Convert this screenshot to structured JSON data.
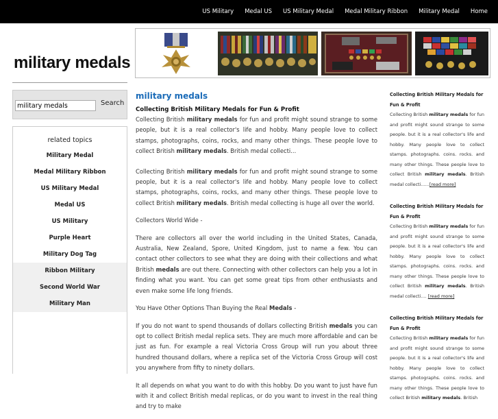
{
  "topnav": [
    "US Military",
    "Medal US",
    "US Military Medal",
    "Medal Military Ribbon",
    "Military Medal",
    "Home"
  ],
  "site_title": "military medals",
  "search": {
    "value": "military medals",
    "button": "Search"
  },
  "topics": {
    "heading": "related topics",
    "items": [
      "Military Medal",
      "Medal Military Ribbon",
      "US Military Medal",
      "Medal US",
      "US Military",
      "Purple Heart",
      "Military Dog Tag",
      "Ribbon Military",
      "Second World War",
      "Military Man"
    ]
  },
  "main": {
    "title": "military medals",
    "article_title": "Collecting British Military Medals for Fun & Profit",
    "p1_a": "Collecting British ",
    "p1_b": "military medals",
    "p1_c": " for fun and profit might sound strange to some people, but it is a real collector's life and hobby. Many people love to collect stamps, photographs, coins, rocks, and many other things. These people love to collect British ",
    "p1_d": "military medals",
    "p1_e": ". British medal collecti...",
    "p2_a": "Collecting British ",
    "p2_b": "military medals",
    "p2_c": " for fun and profit might sound strange to some people, but it is a real collector's life and hobby. Many people love to collect stamps, photographs, coins, rocks, and many other things. These people love to collect British ",
    "p2_d": "military medals",
    "p2_e": ". British medal collecting is huge all over the world.",
    "p3": "Collectors World Wide -",
    "p4_a": "There are collectors all over the world including in the United States, Canada, Australia, New Zealand, Spore, United Kingdom, just to name a few. You can contact other collectors to see what they are doing with their collections and what British ",
    "p4_b": "medals",
    "p4_c": " are out there. Connecting with other collectors can help you a lot in finding what you want. You can get some great tips from other enthusiasts and even make some life long friends.",
    "p5_a": "You Have Other Options Than Buying the Real ",
    "p5_b": "Medals",
    "p5_c": " -",
    "p6_a": "If you do not want to spend thousands of dollars collecting British ",
    "p6_b": "medals",
    "p6_c": " you can opt to collect British medal replica sets. They are much more affordable and can be just as fun. For example a real Victoria Cross Group will run you about three hundred thousand dollars, where a replica set of the Victoria Cross Group will cost you anywhere from fifty to ninety dollars.",
    "p7": "It all depends on what you want to do with this hobby. Do you want to just have fun with it and collect British medal replicas, or do you want to invest in the real thing and try to make"
  },
  "side": {
    "title": "Collecting British Military Medals for Fun & Profit",
    "t_a": "Collecting British ",
    "t_b": "military medals",
    "t_c": " for fun and profit might sound strange to some people. but it is a real collector's life and hobby. Many people love to collect stamps. photographs. coins. rocks. and many other things. These people love to collect British ",
    "t_d": "military medals",
    "t_e": ". British medal collecti......",
    "t_e2": ". British medal collecti.... ",
    "t_last": ". British",
    "readmore": "[read more]"
  },
  "colors": {
    "topbar": "#000000",
    "accent_title": "#1a6bb8"
  }
}
